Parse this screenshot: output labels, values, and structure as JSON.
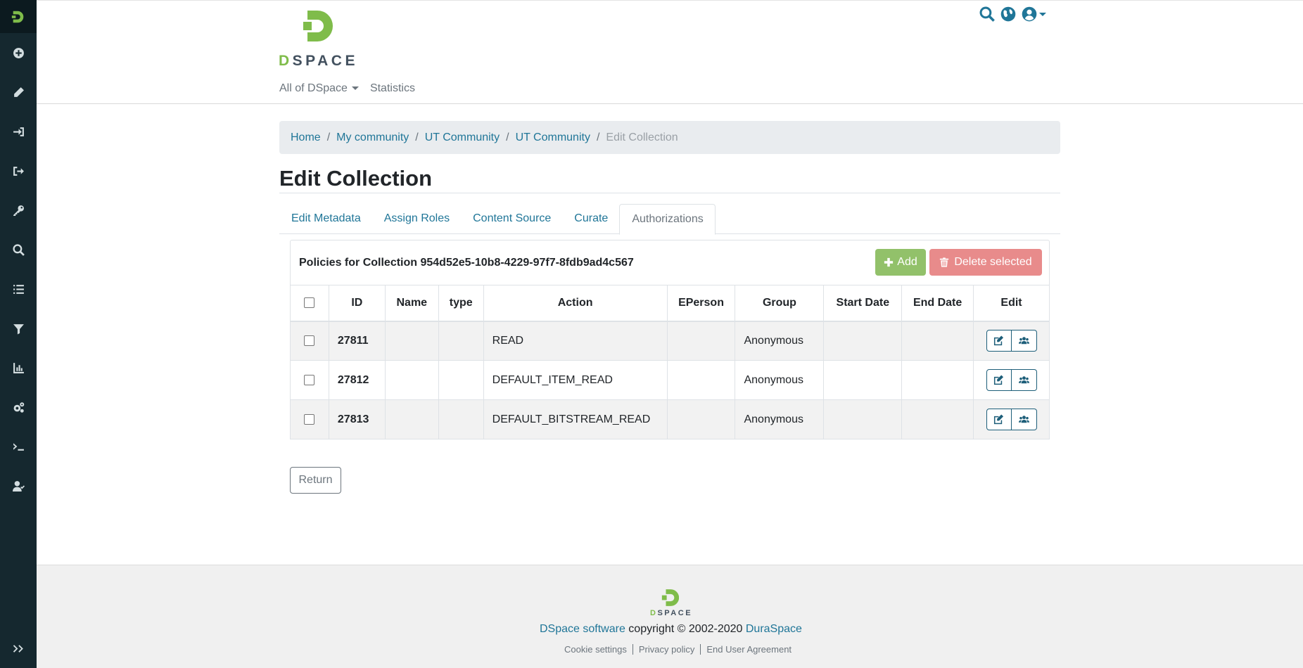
{
  "header": {
    "brand_text_d": "D",
    "brand_text_rest": "SPACE",
    "nav": {
      "all_of_dspace": "All of DSpace",
      "statistics": "Statistics"
    }
  },
  "breadcrumb": {
    "items": [
      "Home",
      "My community",
      "UT Community",
      "UT Community"
    ],
    "active": "Edit Collection"
  },
  "page": {
    "title": "Edit Collection"
  },
  "tabs": [
    "Edit Metadata",
    "Assign Roles",
    "Content Source",
    "Curate",
    "Authorizations"
  ],
  "policies": {
    "title": "Policies for Collection 954d52e5-10b8-4229-97f7-8fdb9ad4c567",
    "add_label": "Add",
    "delete_label": "Delete selected",
    "columns": [
      "ID",
      "Name",
      "type",
      "Action",
      "EPerson",
      "Group",
      "Start Date",
      "End Date",
      "Edit"
    ],
    "rows": [
      {
        "id": "27811",
        "name": "",
        "type": "",
        "action": "READ",
        "eperson": "",
        "group": "Anonymous",
        "start": "",
        "end": ""
      },
      {
        "id": "27812",
        "name": "",
        "type": "",
        "action": "DEFAULT_ITEM_READ",
        "eperson": "",
        "group": "Anonymous",
        "start": "",
        "end": ""
      },
      {
        "id": "27813",
        "name": "",
        "type": "",
        "action": "DEFAULT_BITSTREAM_READ",
        "eperson": "",
        "group": "Anonymous",
        "start": "",
        "end": ""
      }
    ]
  },
  "return_label": "Return",
  "footer": {
    "logo_d": "D",
    "logo_rest": "SPACE",
    "software_link": "DSpace software",
    "copyright_text": " copyright © 2002-2020 ",
    "duraspace_link": "DuraSpace",
    "links": [
      "Cookie settings",
      "Privacy policy",
      "End User Agreement"
    ]
  },
  "icons": {
    "sidebar": [
      "plus-circle-icon",
      "pencil-icon",
      "import-icon",
      "export-icon",
      "key-icon",
      "search-icon",
      "list-icon",
      "filter-icon",
      "chart-icon",
      "cogs-icon",
      "terminal-icon",
      "user-check-icon",
      "expand-icon"
    ],
    "header": [
      "search-icon",
      "globe-icon",
      "user-circle-icon"
    ]
  },
  "colors": {
    "sidebar_bg": "#15282f",
    "link": "#207698",
    "add_button": "#92c16a",
    "delete_button": "#e88b8b",
    "brand_green": "#7fbc4a"
  }
}
